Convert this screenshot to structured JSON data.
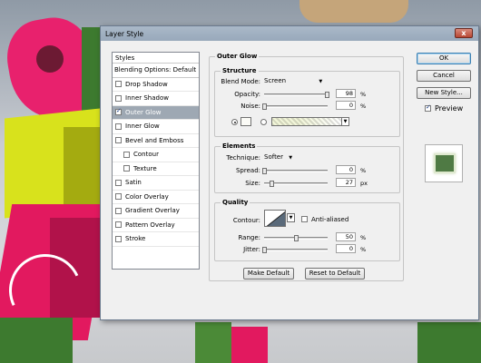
{
  "window": {
    "title": "Layer Style",
    "close_glyph": "x"
  },
  "styles_list": {
    "header": "Styles",
    "blending_options": "Blending Options: Default",
    "items": [
      {
        "label": "Drop Shadow",
        "checked": false,
        "selected": false,
        "indent": false
      },
      {
        "label": "Inner Shadow",
        "checked": false,
        "selected": false,
        "indent": false
      },
      {
        "label": "Outer Glow",
        "checked": true,
        "selected": true,
        "indent": false
      },
      {
        "label": "Inner Glow",
        "checked": false,
        "selected": false,
        "indent": false
      },
      {
        "label": "Bevel and Emboss",
        "checked": false,
        "selected": false,
        "indent": false
      },
      {
        "label": "Contour",
        "checked": false,
        "selected": false,
        "indent": true
      },
      {
        "label": "Texture",
        "checked": false,
        "selected": false,
        "indent": true
      },
      {
        "label": "Satin",
        "checked": false,
        "selected": false,
        "indent": false
      },
      {
        "label": "Color Overlay",
        "checked": false,
        "selected": false,
        "indent": false
      },
      {
        "label": "Gradient Overlay",
        "checked": false,
        "selected": false,
        "indent": false
      },
      {
        "label": "Pattern Overlay",
        "checked": false,
        "selected": false,
        "indent": false
      },
      {
        "label": "Stroke",
        "checked": false,
        "selected": false,
        "indent": false
      }
    ]
  },
  "outer_glow": {
    "title": "Outer Glow",
    "structure": {
      "title": "Structure",
      "blend_mode_label": "Blend Mode:",
      "blend_mode_value": "Screen",
      "opacity_label": "Opacity:",
      "opacity_value": "98",
      "opacity_unit": "%",
      "opacity_level": 98,
      "noise_label": "Noise:",
      "noise_value": "0",
      "noise_unit": "%",
      "noise_level": 0,
      "color_mode": "solid",
      "glow_color": "#fbfbf6"
    },
    "elements": {
      "title": "Elements",
      "technique_label": "Technique:",
      "technique_value": "Softer",
      "spread_label": "Spread:",
      "spread_value": "0",
      "spread_unit": "%",
      "spread_level": 0,
      "size_label": "Size:",
      "size_value": "27",
      "size_unit": "px",
      "size_level": 27
    },
    "quality": {
      "title": "Quality",
      "contour_label": "Contour:",
      "anti_aliased_label": "Anti-aliased",
      "anti_aliased": false,
      "range_label": "Range:",
      "range_value": "50",
      "range_unit": "%",
      "range_level": 50,
      "jitter_label": "Jitter:",
      "jitter_value": "0",
      "jitter_unit": "%",
      "jitter_level": 0
    },
    "make_default": "Make Default",
    "reset_default": "Reset to Default"
  },
  "buttons": {
    "ok": "OK",
    "cancel": "Cancel",
    "new_style": "New Style...",
    "preview_label": "Preview",
    "preview_checked": true
  },
  "colors": {
    "selected_row": "#9ea8b3",
    "preview_swatch": "#4f7a44"
  }
}
